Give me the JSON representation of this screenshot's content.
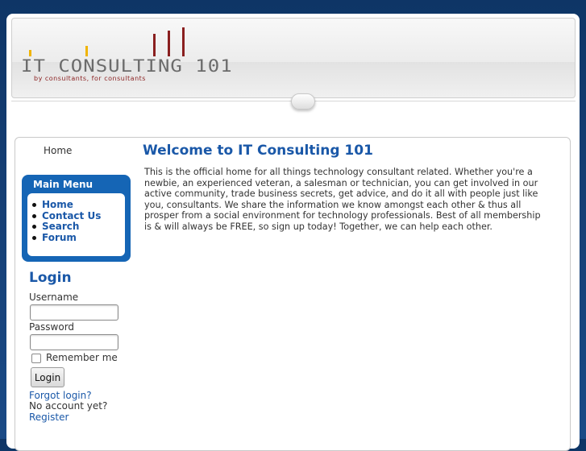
{
  "header": {
    "logo_text": "IT CONSULTING 101",
    "logo_tagline": "by consultants, for consultants"
  },
  "breadcrumb": {
    "home": "Home"
  },
  "main_menu": {
    "title": "Main Menu",
    "items": [
      {
        "label": "Home"
      },
      {
        "label": "Contact Us"
      },
      {
        "label": "Search"
      },
      {
        "label": "Forum"
      }
    ]
  },
  "login": {
    "title": "Login",
    "username_label": "Username",
    "username_value": "",
    "password_label": "Password",
    "password_value": "",
    "remember_label": "Remember me",
    "remember_checked": false,
    "button_label": "Login",
    "forgot_link": "Forgot login?",
    "no_account_text": "No account yet?",
    "register_link": "Register"
  },
  "article": {
    "title": "Welcome to IT Consulting 101",
    "body": "This is the official home for all things technology consultant related.  Whether you're a newbie, an experienced veteran, a salesman or technician, you can get involved in our active community, trade business secrets, get advice, and do it all with people just like you, consultants.  We share the information we know amongst each other & thus all prosper from a social environment for technology professionals.  Best of all membership is & will always be FREE, so sign up today!  Together, we can help each other."
  },
  "colors": {
    "page_background": "#153e73",
    "accent_blue": "#1565b5",
    "link_blue": "#1a58a8",
    "logo_red": "#8a1f1f",
    "logo_yellow": "#f0b400"
  }
}
